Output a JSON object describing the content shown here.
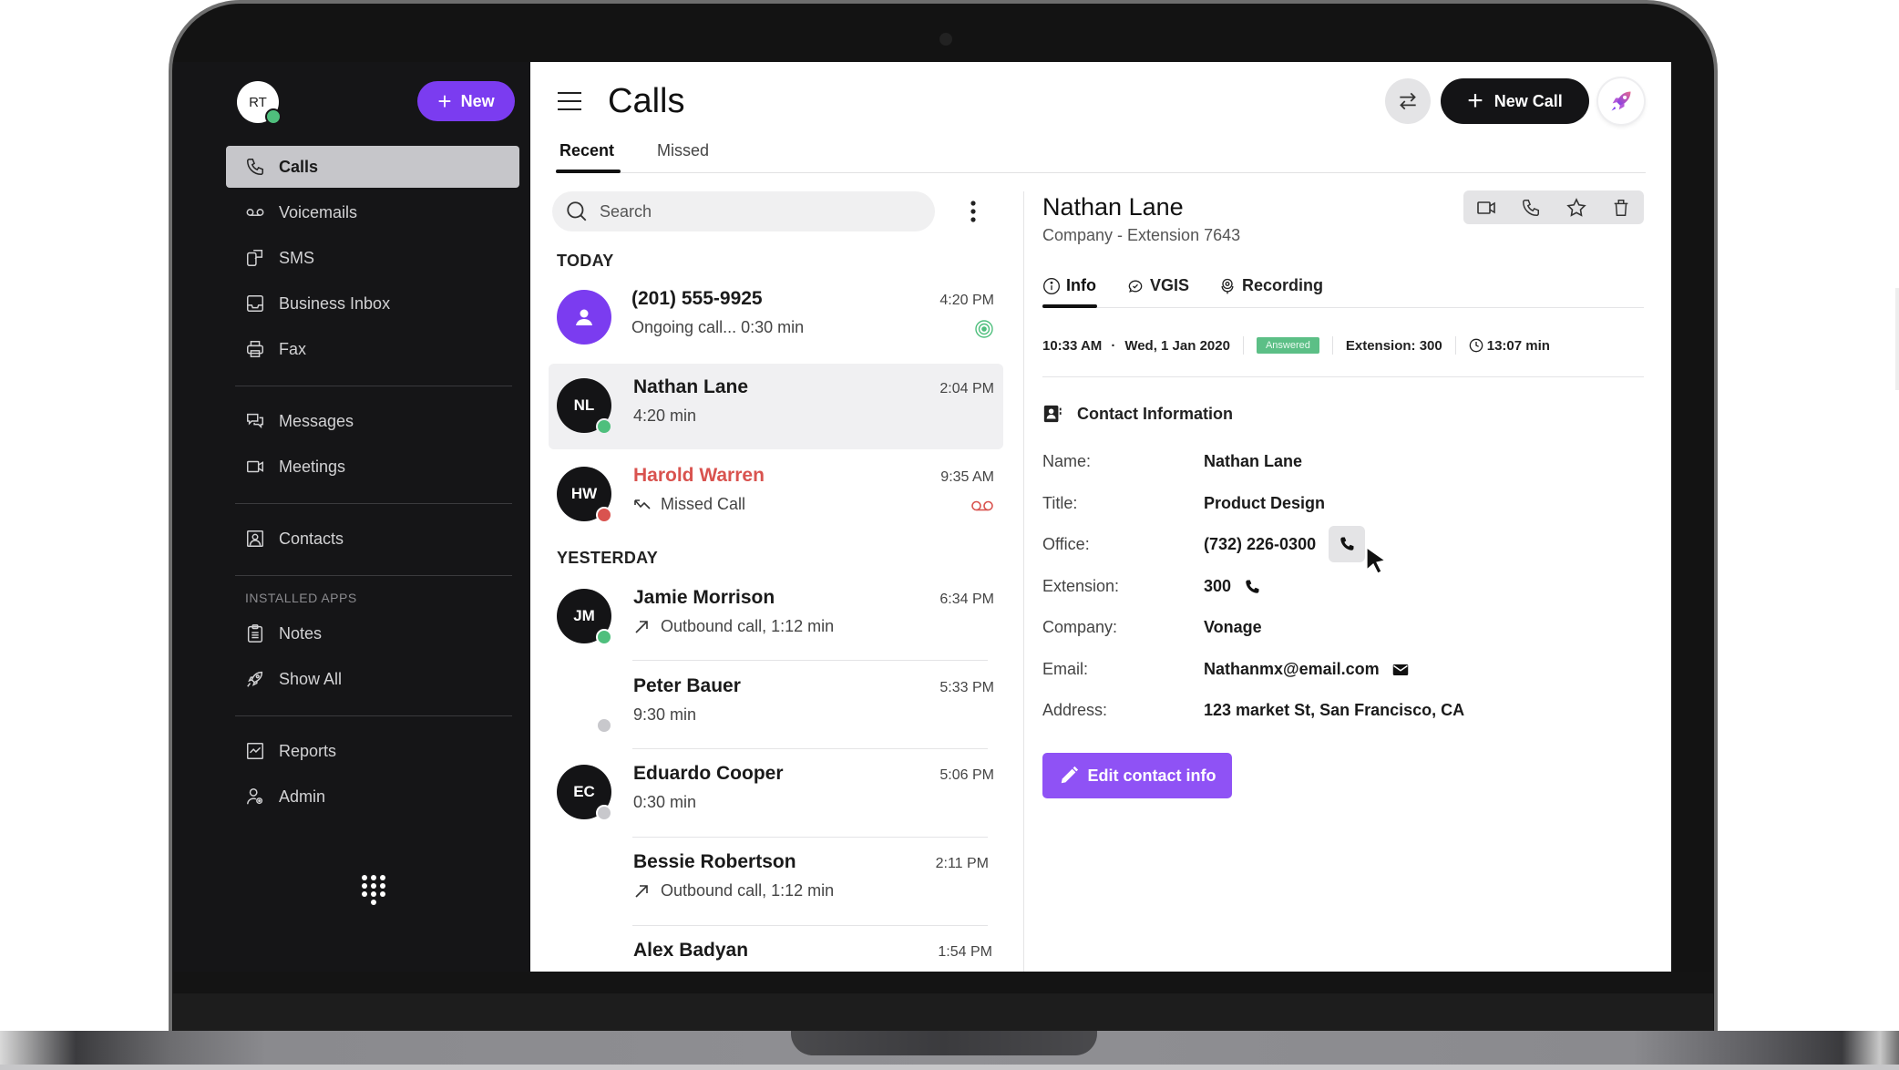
{
  "sidebar": {
    "user_initials": "RT",
    "user_status_color": "#4fbf7d",
    "new_button_label": "New",
    "items": [
      {
        "label": "Calls",
        "icon": "phone-icon",
        "active": true
      },
      {
        "label": "Voicemails",
        "icon": "voicemail-icon"
      },
      {
        "label": "SMS",
        "icon": "sms-icon"
      },
      {
        "label": "Business Inbox",
        "icon": "inbox-icon"
      },
      {
        "label": "Fax",
        "icon": "printer-icon"
      },
      {
        "label": "Messages",
        "icon": "messages-icon"
      },
      {
        "label": "Meetings",
        "icon": "video-icon"
      },
      {
        "label": "Contacts",
        "icon": "contact-card-icon"
      },
      {
        "label": "Notes",
        "icon": "clipboard-icon"
      },
      {
        "label": "Show All",
        "icon": "rocket-icon"
      },
      {
        "label": "Reports",
        "icon": "chart-icon"
      },
      {
        "label": "Admin",
        "icon": "admin-user-icon"
      }
    ],
    "section_installed_apps": "INSTALLED APPS",
    "dialpad_icon": "dialpad-icon"
  },
  "header": {
    "title": "Calls",
    "tabs": [
      {
        "label": "Recent",
        "active": true
      },
      {
        "label": "Missed",
        "active": false
      }
    ],
    "swap_icon": "swap-arrows-icon",
    "new_call_label": "New Call",
    "rocket_icon": "rocket-icon"
  },
  "search": {
    "placeholder": "Search",
    "value": ""
  },
  "call_list": {
    "sections": [
      {
        "label": "TODAY",
        "calls": [
          {
            "name": "(201) 555-9925",
            "initials": "",
            "avatar": "purple-person",
            "sub": "Ongoing call... 0:30 min",
            "time": "4:20 PM",
            "trail_icon": "ongoing-call-icon",
            "status": null
          },
          {
            "name": "Nathan Lane",
            "initials": "NL",
            "sub": "4:20 min",
            "time": "2:04 PM",
            "status": "online",
            "selected": true
          },
          {
            "name": "Harold Warren",
            "initials": "HW",
            "sub": "Missed Call",
            "sub_icon": "missed-call-icon",
            "time": "9:35 AM",
            "trail_icon": "voicemail-icon",
            "status": "busy",
            "missed": true
          }
        ]
      },
      {
        "label": "YESTERDAY",
        "calls": [
          {
            "name": "Jamie Morrison",
            "initials": "JM",
            "sub": "Outbound call, 1:12 min",
            "sub_icon": "outbound-arrow-icon",
            "time": "6:34 PM",
            "status": "online"
          },
          {
            "name": "Peter Bauer",
            "initials": "",
            "sub": "9:30 min",
            "time": "5:33 PM",
            "status": "offline"
          },
          {
            "name": "Eduardo Cooper",
            "initials": "EC",
            "sub": "0:30 min",
            "time": "5:06 PM",
            "status": "offline"
          },
          {
            "name": "Bessie Robertson",
            "initials": "",
            "sub": "Outbound call, 1:12 min",
            "sub_icon": "outbound-arrow-icon",
            "time": "2:11 PM",
            "status": null
          },
          {
            "name": "Alex Badyan",
            "initials": "",
            "sub": "",
            "time": "1:54 PM",
            "status": null
          }
        ]
      }
    ],
    "status_colors": {
      "online": "#4fbf7d",
      "busy": "#d9534f",
      "offline": "#c8c8cc"
    }
  },
  "detail": {
    "name": "Nathan Lane",
    "subtitle": "Company -  Extension 7643",
    "actions": [
      "video-icon",
      "phone-icon",
      "star-icon",
      "trash-icon"
    ],
    "tabs": [
      {
        "label": "Info",
        "icon": "info-icon",
        "active": true
      },
      {
        "label": "VGIS",
        "icon": "heart-chat-icon"
      },
      {
        "label": "Recording",
        "icon": "microphone-icon"
      }
    ],
    "meta": {
      "time": "10:33 AM",
      "date": "Wed, 1 Jan 2020",
      "status": "Answered",
      "extension": "Extension:  300",
      "duration": "13:07 min"
    },
    "contact_info_title": "Contact Information",
    "fields": [
      {
        "label": "Name:",
        "value": "Nathan Lane"
      },
      {
        "label": "Title:",
        "value": "Product  Design"
      },
      {
        "label": "Office:",
        "value": "(732) 226-0300",
        "icon": "phone-icon"
      },
      {
        "label": "Extension:",
        "value": "300",
        "icon": "phone-icon"
      },
      {
        "label": "Company:",
        "value": "Vonage"
      },
      {
        "label": "Email:",
        "value": "Nathanmx@email.com",
        "icon": "mail-icon"
      },
      {
        "label": "Address:",
        "value": "123 market St, San Francisco, CA"
      }
    ],
    "edit_button_label": "Edit contact info"
  },
  "colors": {
    "accent_purple": "#7b3cf0",
    "edit_purple": "#8f52f5",
    "answered_green": "#5cbf86",
    "missed_red": "#d9534f"
  }
}
